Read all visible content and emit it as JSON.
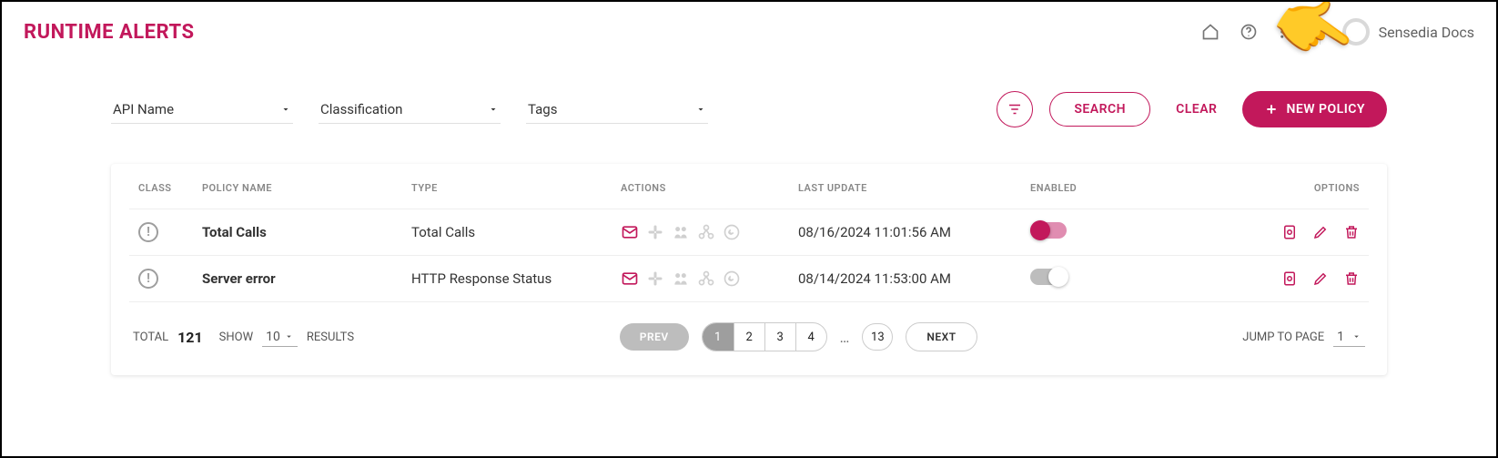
{
  "header": {
    "title": "RUNTIME ALERTS",
    "user": "Sensedia Docs"
  },
  "filters": {
    "api_name": "API Name",
    "classification": "Classification",
    "tags": "Tags",
    "search_label": "SEARCH",
    "clear_label": "CLEAR",
    "new_policy_label": "NEW POLICY"
  },
  "table": {
    "headers": {
      "class": "CLASS",
      "policy_name": "POLICY NAME",
      "type": "TYPE",
      "actions": "ACTIONS",
      "last_update": "LAST UPDATE",
      "enabled": "ENABLED",
      "options": "OPTIONS"
    },
    "rows": [
      {
        "class_icon": "!",
        "policy_name": "Total Calls",
        "type": "Total Calls",
        "last_update": "08/16/2024 11:01:56 AM",
        "enabled": true
      },
      {
        "class_icon": "!",
        "policy_name": "Server error",
        "type": "HTTP Response Status",
        "last_update": "08/14/2024 11:53:00 AM",
        "enabled": false
      }
    ]
  },
  "pager": {
    "total_label": "TOTAL",
    "total": "121",
    "show_label": "SHOW",
    "show_value": "10",
    "results_label": "RESULTS",
    "prev": "PREV",
    "next": "NEXT",
    "pages": [
      "1",
      "2",
      "3",
      "4"
    ],
    "ellipsis": "…",
    "last_page": "13",
    "jump_label": "JUMP TO PAGE",
    "jump_value": "1"
  }
}
